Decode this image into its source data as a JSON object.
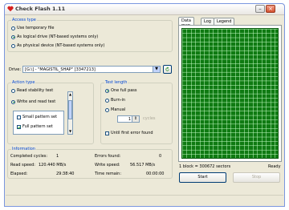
{
  "window": {
    "title": "Check Flash 1.11"
  },
  "access_type": {
    "legend": "Access type",
    "options": [
      {
        "label": "Use temporary file",
        "selected": false
      },
      {
        "label": "As logical drive (NT-based systems only)",
        "selected": true
      },
      {
        "label": "As physical device (NT-based systems only)",
        "selected": false
      }
    ]
  },
  "drive": {
    "label": "Drive:",
    "value": "[G:\\] - \"MAGISTIL_SHAP\" [3347213]"
  },
  "action_type": {
    "legend": "Action type",
    "options": [
      {
        "label": "Read stability test",
        "selected": false
      },
      {
        "label": "Write and read test",
        "selected": true
      }
    ],
    "list": [
      "Small pattern set",
      "Full pattern set"
    ]
  },
  "test_length": {
    "legend": "Test length",
    "options": [
      {
        "label": "One full pass",
        "selected": true
      },
      {
        "label": "Burn-in",
        "selected": false
      },
      {
        "label": "Manual",
        "selected": false
      }
    ],
    "cycles_value": "1",
    "cycles_unit": "cycles",
    "until_error": "Until first error found"
  },
  "information": {
    "legend": "Information",
    "rows": [
      {
        "l1": "Completed cycles:",
        "v1": "1",
        "l2": "Errors found:",
        "v2": "0"
      },
      {
        "l1": "Read speed:",
        "v1": "120.440 MB/s",
        "l2": "Write speed:",
        "v2": "56.517 MB/s"
      },
      {
        "l1": "Elapsed:",
        "v1": "29:38:40",
        "l2": "Time remain:",
        "v2": "00:00:00"
      }
    ]
  },
  "tabs": {
    "items": [
      "Data map",
      "Log",
      "Legend"
    ],
    "active": 0
  },
  "map_status": {
    "left": "1 block = 300672 sectors",
    "right": "Ready"
  },
  "buttons": {
    "start": "Start",
    "stop": "Stop"
  },
  "colors": {
    "map_fill": "#0f7a12",
    "map_grid": "#c9ffc9",
    "accent": "#0046d5"
  }
}
